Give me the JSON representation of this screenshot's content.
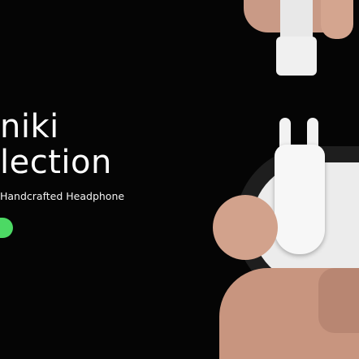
{
  "hero": {
    "title_line1": "niki",
    "title_line2": "lection",
    "subtitle": "Handcrafted Headphone",
    "cta_color": "#4cd964"
  },
  "image": {
    "icon": "headphone-product-photo"
  }
}
